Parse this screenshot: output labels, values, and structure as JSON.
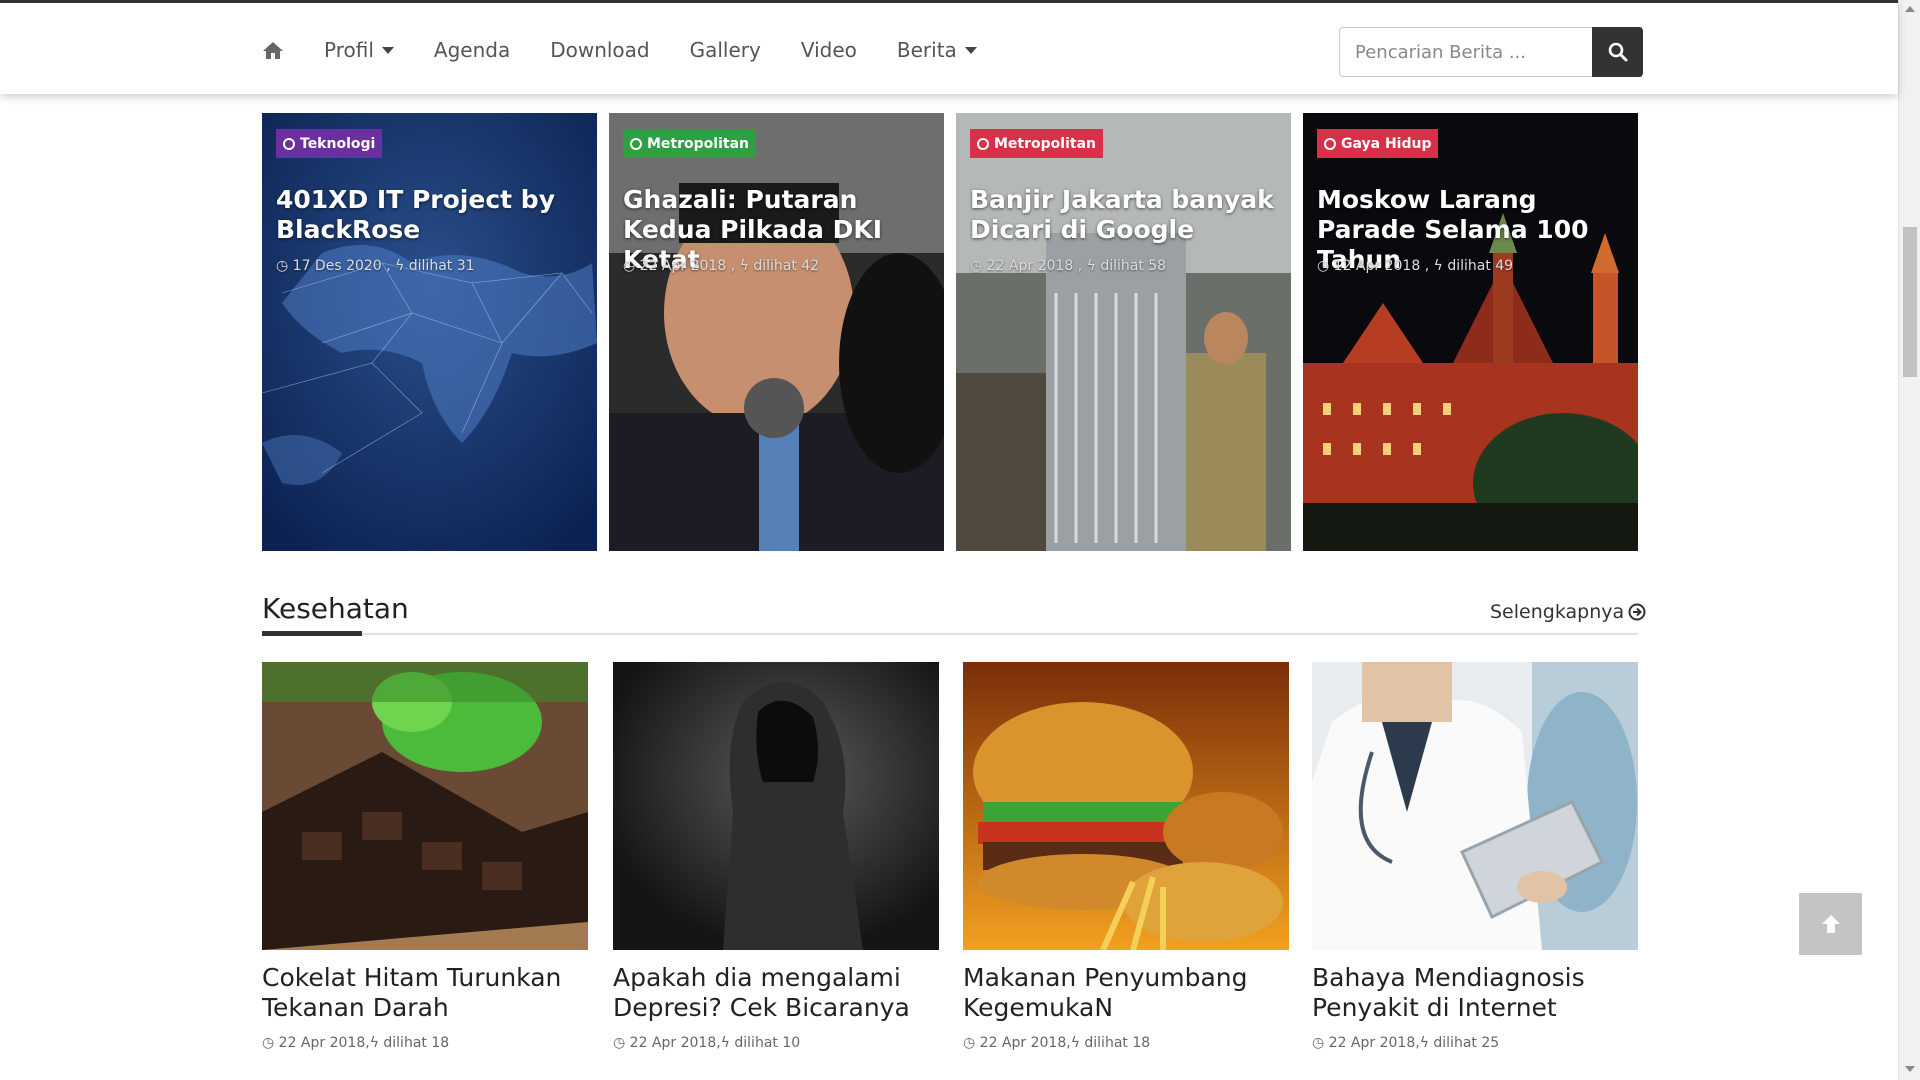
{
  "nav": {
    "home_icon": "home-icon",
    "items": [
      {
        "label": "Profil",
        "dropdown": true
      },
      {
        "label": "Agenda",
        "dropdown": false
      },
      {
        "label": "Download",
        "dropdown": false
      },
      {
        "label": "Gallery",
        "dropdown": false
      },
      {
        "label": "Video",
        "dropdown": false
      },
      {
        "label": "Berita",
        "dropdown": true
      }
    ],
    "search_placeholder": "Pencarian Berita ...",
    "search_icon": "search-icon"
  },
  "featured": [
    {
      "category": "Teknologi",
      "badge_color": "#6b2fa0",
      "title": "401XD IT Project by BlackRose",
      "date": "17 Des 2020",
      "views": "dilihat 31"
    },
    {
      "category": "Metropolitan",
      "badge_color": "#2ea043",
      "title": "Ghazali: Putaran Kedua Pilkada DKI Ketat",
      "date": "22 Apr 2018",
      "views": "dilihat 42"
    },
    {
      "category": "Metropolitan",
      "badge_color": "#d9304a",
      "title": "Banjir Jakarta banyak Dicari di Google",
      "date": "22 Apr 2018",
      "views": "dilihat 58"
    },
    {
      "category": "Gaya Hidup",
      "badge_color": "#d9304a",
      "title": "Moskow Larang Parade Selama 100 Tahun",
      "date": "12 Apr 2018",
      "views": "dilihat 49"
    }
  ],
  "section": {
    "title": "Kesehatan",
    "more_label": "Selengkapnya"
  },
  "articles": [
    {
      "title": "Cokelat Hitam Turunkan Tekanan Darah",
      "date": "22 Apr 2018",
      "views": "dilihat 18"
    },
    {
      "title": "Apakah dia mengalami Depresi? Cek Bicaranya",
      "date": "22 Apr 2018",
      "views": "dilihat 10"
    },
    {
      "title": "Makanan Penyumbang KegemukaN",
      "date": "22 Apr 2018",
      "views": "dilihat 18"
    },
    {
      "title": "Bahaya Mendiagnosis Penyakit di Internet",
      "date": "22 Apr 2018",
      "views": "dilihat 25"
    }
  ],
  "meta_separator": " , ",
  "to_top_icon": "arrow-up-icon"
}
